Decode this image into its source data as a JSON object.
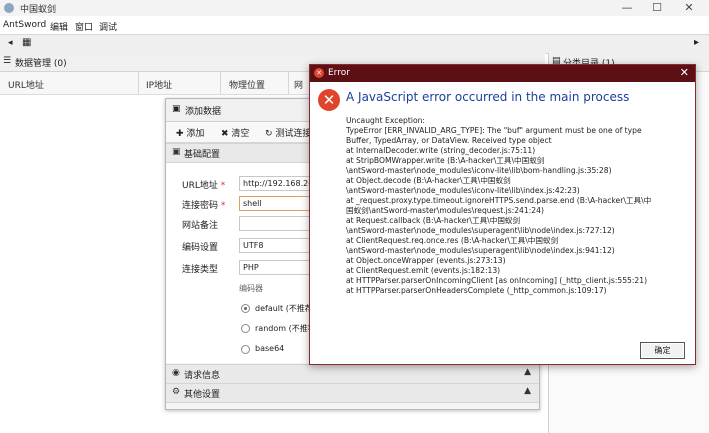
{
  "window": {
    "title": "中国蚁剑",
    "minimize": "—",
    "maximize": "☐",
    "close": "✕"
  },
  "menu": [
    "AntSword",
    "编辑",
    "窗口",
    "调试"
  ],
  "tabs": {
    "left_arrow": "◂",
    "grid": "▦"
  },
  "data_panel": {
    "title": "数据管理 (0)",
    "columns": [
      "URL地址",
      "IP地址",
      "物理位置",
      "网"
    ]
  },
  "right_panel": {
    "title": "分类目录 (1)"
  },
  "add_dialog": {
    "title": "添加数据",
    "toolbar": {
      "add": "添加",
      "clear": "清空",
      "test": "测试连接"
    },
    "sections": {
      "basic": "基础配置",
      "request": "请求信息",
      "other": "其他设置"
    },
    "fields": [
      {
        "label": "URL地址",
        "required": true,
        "value": "http://192.168.209"
      },
      {
        "label": "连接密码",
        "required": true,
        "value": "shell"
      },
      {
        "label": "网站备注",
        "required": false,
        "value": ""
      },
      {
        "label": "编码设置",
        "required": false,
        "value": "UTF8"
      },
      {
        "label": "连接类型",
        "required": false,
        "value": "PHP"
      }
    ],
    "encoder_label": "编码器",
    "encoders": [
      "default (不推荐",
      "random (不推荐",
      "base64"
    ]
  },
  "error_dialog": {
    "title": "Error",
    "heading": "A JavaScript error occurred in the main process",
    "lines": [
      "Uncaught Exception:",
      "TypeError [ERR_INVALID_ARG_TYPE]: The \"buf\" argument must be one of type",
      "Buffer, TypedArray, or DataView. Received type object",
      "    at InternalDecoder.write (string_decoder.js:75:11)",
      "    at StripBOMWrapper.write (B:\\A-hacker\\工具\\中国蚁剑",
      "\\antSword-master\\node_modules\\iconv-lite\\lib\\bom-handling.js:35:28)",
      "    at Object.decode (B:\\A-hacker\\工具\\中国蚁剑",
      "\\antSword-master\\node_modules\\iconv-lite\\lib\\index.js:42:23)",
      "    at _request.proxy.type.timeout.ignoreHTTPS.send.parse.end (B:\\A-hacker\\工具\\中",
      "国蚁剑\\antSword-master\\modules\\request.js:241:24)",
      "    at Request.callback (B:\\A-hacker\\工具\\中国蚁剑",
      "\\antSword-master\\node_modules\\superagent\\lib\\node\\index.js:727:12)",
      "    at ClientRequest.req.once.res (B:\\A-hacker\\工具\\中国蚁剑",
      "\\antSword-master\\node_modules\\superagent\\lib\\node\\index.js:941:12)",
      "    at Object.onceWrapper (events.js:273:13)",
      "    at ClientRequest.emit (events.js:182:13)",
      "    at HTTPParser.parserOnIncomingClient [as onIncoming] (_http_client.js:555:21)",
      "    at HTTPParser.parserOnHeadersComplete (_http_common.js:109:17)"
    ],
    "ok_label": "确定"
  }
}
